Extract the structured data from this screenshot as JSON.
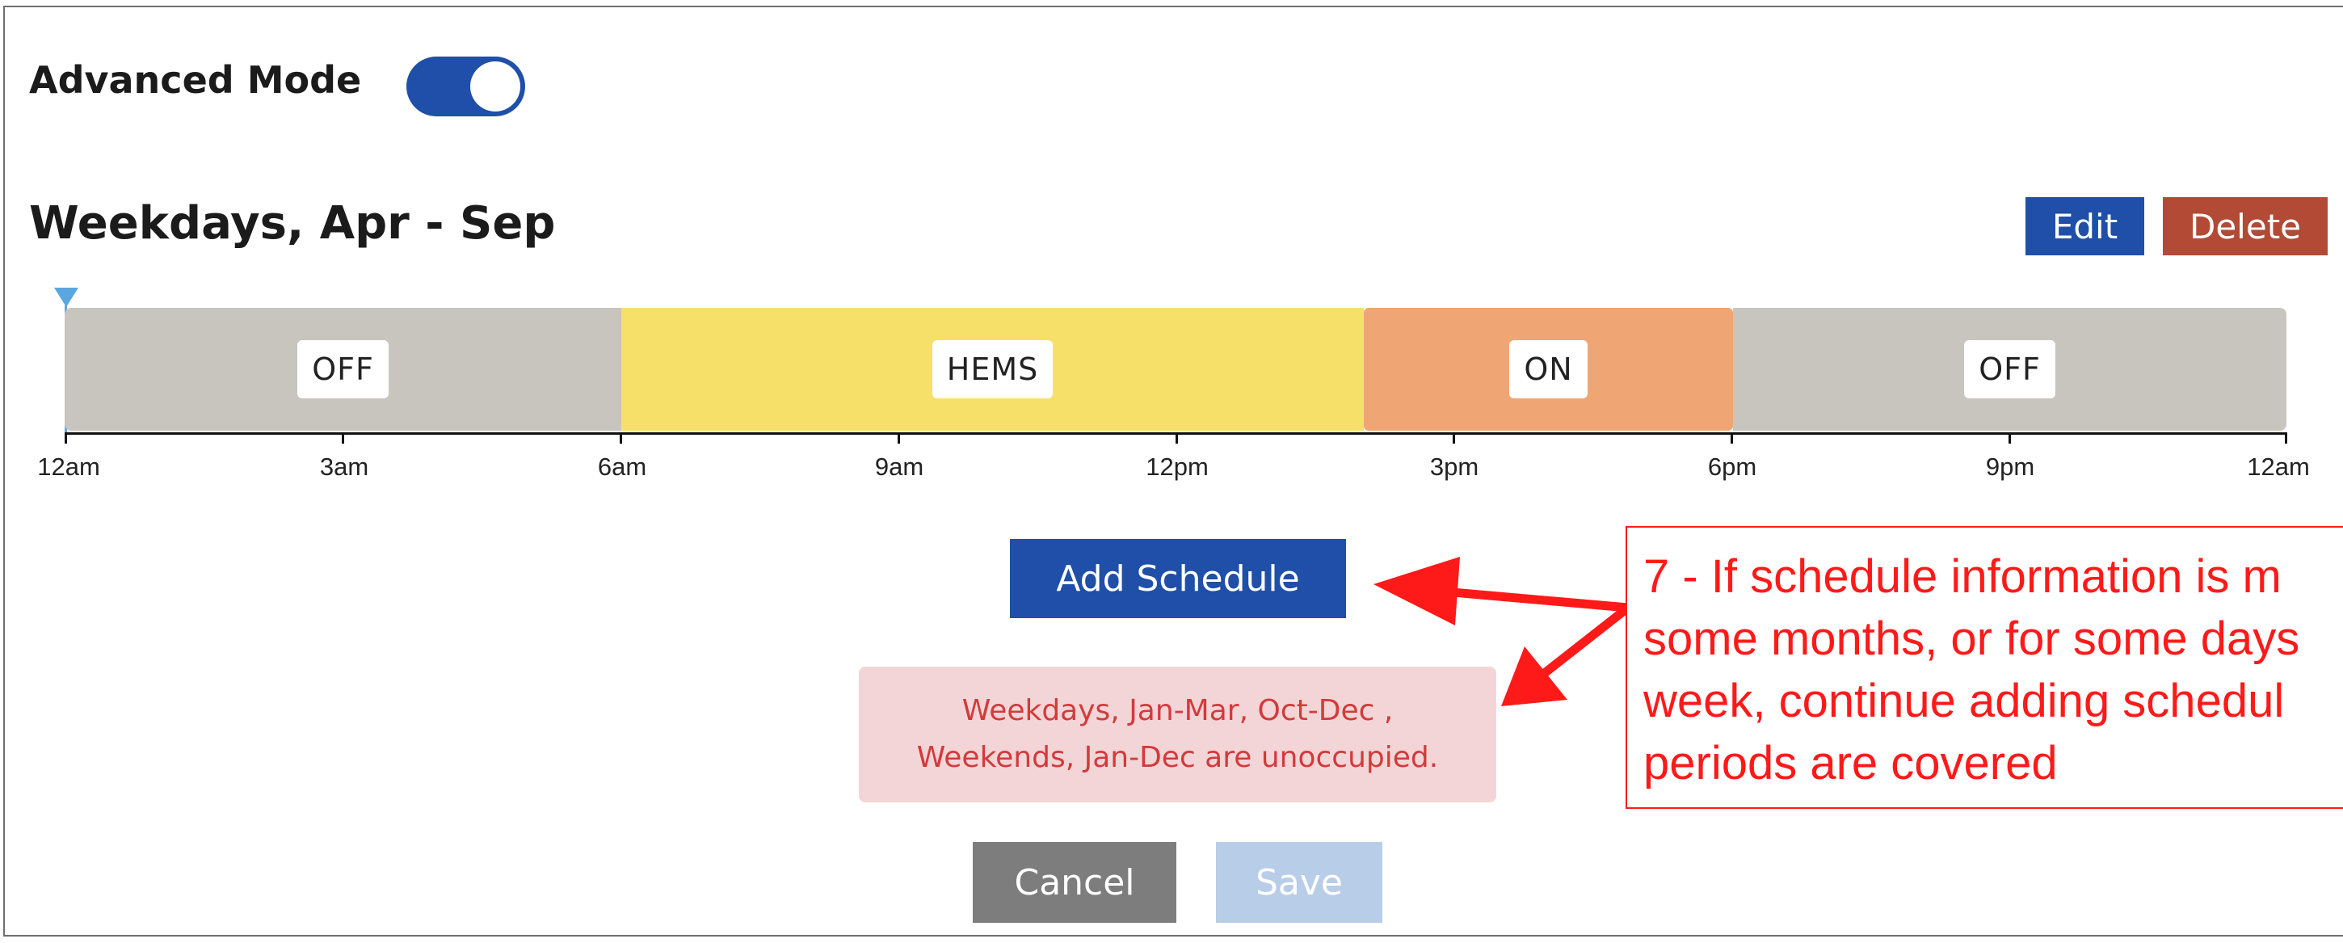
{
  "advanced_mode": {
    "label": "Advanced Mode",
    "enabled": true
  },
  "schedule": {
    "title": "Weekdays, Apr - Sep",
    "edit_label": "Edit",
    "delete_label": "Delete",
    "segments": [
      {
        "label": "OFF",
        "start": "12am",
        "end": "6am",
        "color": "#c8c5bf"
      },
      {
        "label": "HEMS",
        "start": "6am",
        "end": "2pm",
        "color": "#f7e06a"
      },
      {
        "label": "ON",
        "start": "2pm",
        "end": "6pm",
        "color": "#f0a574"
      },
      {
        "label": "OFF",
        "start": "6pm",
        "end": "12am",
        "color": "#c8c5bf"
      }
    ],
    "ticks": [
      "12am",
      "3am",
      "6am",
      "9am",
      "12pm",
      "3pm",
      "6pm",
      "9pm",
      "12am"
    ]
  },
  "add_schedule_label": "Add Schedule",
  "warning": {
    "line1": "Weekdays, Jan-Mar, Oct-Dec ,",
    "line2": "Weekends, Jan-Dec are unoccupied."
  },
  "annotation": {
    "text": "7 - If schedule information is m\nsome months, or for some days\nweek, continue adding schedul\nperiods are covered"
  },
  "footer": {
    "cancel_label": "Cancel",
    "save_label": "Save"
  },
  "colors": {
    "primary": "#1f4fa8",
    "danger": "#b24a35",
    "warning_bg": "#f3d5d8",
    "warning_text": "#d23b3b",
    "annotation": "#ff1a1a"
  }
}
